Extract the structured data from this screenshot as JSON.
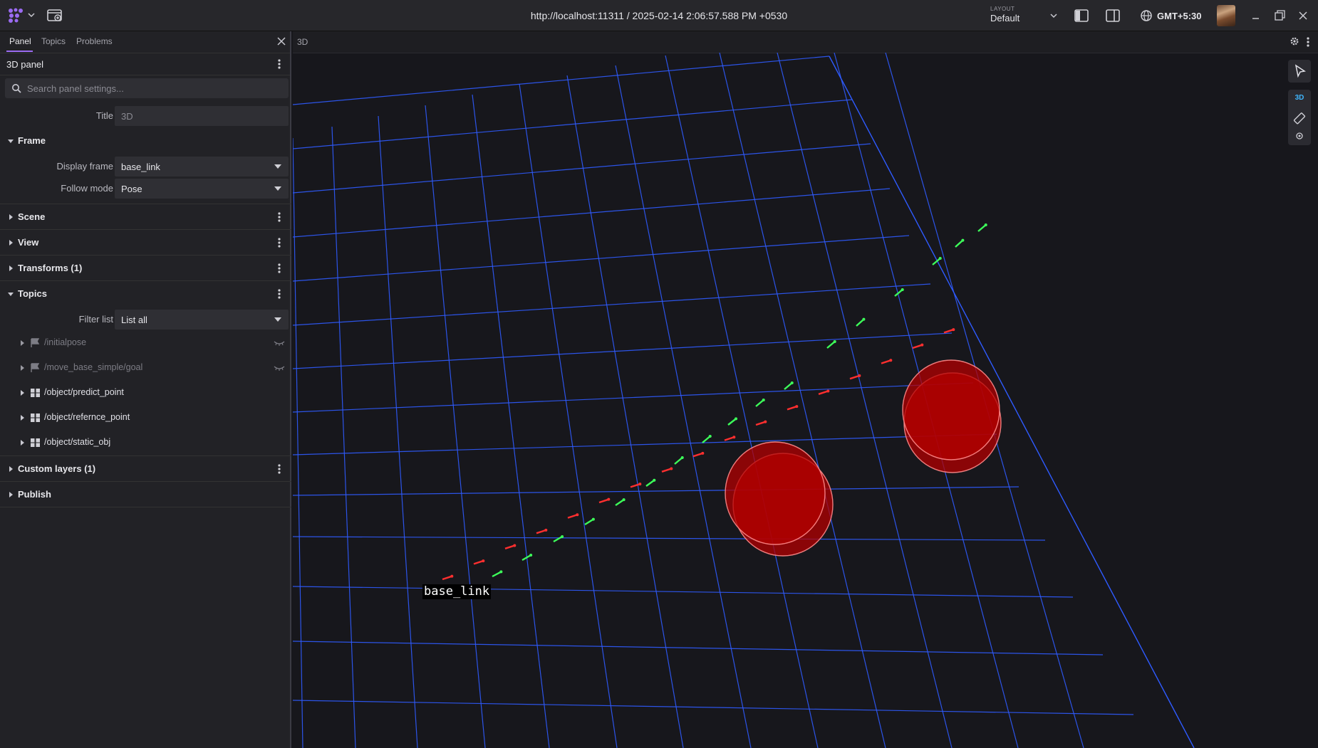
{
  "titlebar": {
    "url": "http://localhost:11311 / 2025-02-14 2:06:57.588 PM +0530",
    "layout_label": "LAYOUT",
    "layout_value": "Default",
    "timezone": "GMT+5:30"
  },
  "sidebar": {
    "tabs": [
      {
        "label": "Panel",
        "active": true
      },
      {
        "label": "Topics",
        "active": false
      },
      {
        "label": "Problems",
        "active": false
      }
    ],
    "panel_title": "3D panel",
    "search_placeholder": "Search panel settings...",
    "title_field": {
      "label": "Title",
      "placeholder": "3D"
    },
    "frame_section": {
      "label": "Frame",
      "display_frame": {
        "label": "Display frame",
        "value": "base_link"
      },
      "follow_mode": {
        "label": "Follow mode",
        "value": "Pose"
      }
    },
    "sections": {
      "scene": "Scene",
      "view": "View",
      "transforms": "Transforms (1)",
      "topics": "Topics",
      "custom_layers": "Custom layers (1)",
      "publish": "Publish"
    },
    "filter_list": {
      "label": "Filter list",
      "value": "List all"
    },
    "topics": [
      {
        "name": "/initialpose",
        "icon": "flag-icon",
        "visible": false
      },
      {
        "name": "/move_base_simple/goal",
        "icon": "flag-icon",
        "visible": false
      },
      {
        "name": "/object/predict_point",
        "icon": "grid-icon",
        "visible": true
      },
      {
        "name": "/object/refernce_point",
        "icon": "grid-icon",
        "visible": true
      },
      {
        "name": "/object/static_obj",
        "icon": "grid-icon",
        "visible": true
      }
    ]
  },
  "viewport": {
    "title": "3D",
    "tool_3d_label": "3D",
    "frame_label": "base_link",
    "colors": {
      "grid": "#2f5bff",
      "predict_arrows": "#3dff5a",
      "reference_arrows": "#ff2f2f",
      "obstacles": "#b30000"
    }
  }
}
